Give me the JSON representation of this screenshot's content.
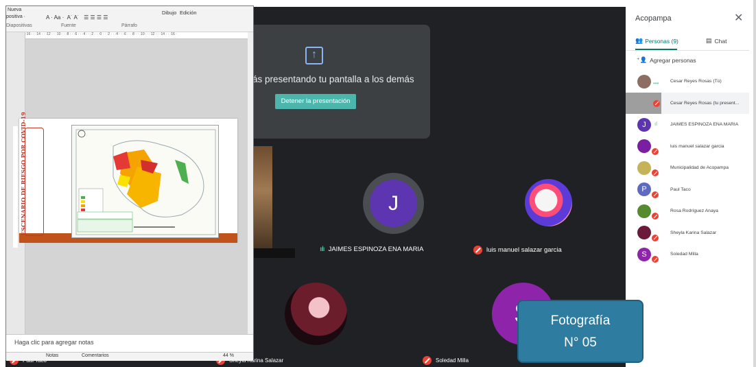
{
  "meet": {
    "present_message": "ás presentando tu pantalla a los demás",
    "stop_button": "Detener la presentación",
    "present_icon": "upload-arrow-icon",
    "tiles": [
      {
        "initial": "J",
        "name": "JAIMES ESPINOZA ENA MARIA"
      },
      {
        "initial": "",
        "name": "luis manuel salazar garcia"
      },
      {
        "initial": "",
        "name": ""
      },
      {
        "initial": "S",
        "name": ""
      }
    ],
    "bottom_names": [
      "Paul Taco",
      "Sheyla Karina Salazar",
      "Soledad Milla"
    ]
  },
  "ppt": {
    "ribbon": {
      "group1_a": "Nueva",
      "group1_b": "positiva ·",
      "group1_label": "Diapositivas",
      "fuente_label": "Fuente",
      "parrafo_label": "Párrafo",
      "dibujo": "Dibujo",
      "edicion": "Edición"
    },
    "ruler_text": "·16 · · ·14 · · ·12 · · ·10 · · ·8 · · ·6 · · ·4 · · ·2 · · ·0 · · ·2 · · ·4 · · ·6 · · ·8 · · ·10 · · ·12 · · ·14 · · ·16 ·",
    "slide_title": "ESCENARIO DE RIESGO POR COVID-19",
    "notes_placeholder": "Haga clic para agregar notas",
    "status": {
      "notes": "Notas",
      "comments": "Comentarios",
      "zoom": "44 %"
    }
  },
  "panel": {
    "title": "Acopampa",
    "tab_people": "Personas (9)",
    "tab_chat": "Chat",
    "add_people": "Agregar personas",
    "participants": [
      {
        "name": "Cesar Reyes Rosas (Tú)",
        "initial": "",
        "color": "#8d6e63"
      },
      {
        "name": "Cesar Reyes Rosas (tu present...",
        "initial": "",
        "color": "#9e9e9e"
      },
      {
        "name": "JAIMES ESPINOZA ENA MARIA",
        "initial": "J",
        "color": "#5e35b1"
      },
      {
        "name": "luis manuel salazar garcia",
        "initial": "",
        "color": "#7b1fa2"
      },
      {
        "name": "Municipalidad de Acopampa",
        "initial": "",
        "color": "#c5b358"
      },
      {
        "name": "Paul Taco",
        "initial": "P",
        "color": "#5c6bc0"
      },
      {
        "name": "Rosa Rodríguez Anaya",
        "initial": "",
        "color": "#558b2f"
      },
      {
        "name": "Sheyla Karina Salazar",
        "initial": "",
        "color": "#6a1b3a"
      },
      {
        "name": "Soledad Milla",
        "initial": "S",
        "color": "#8e24aa"
      }
    ]
  },
  "caption": {
    "line1": "Fotografía",
    "line2": "N° 05"
  }
}
